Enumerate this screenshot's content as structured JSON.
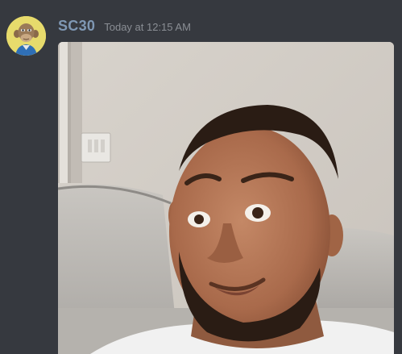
{
  "message": {
    "author": {
      "name": "SC30",
      "avatar_icon": "bored-ape-avatar-icon",
      "name_color": "#7f98b4"
    },
    "timestamp": "Today at 12:15 AM",
    "attachment": {
      "kind": "image",
      "icon": "selfie-photo"
    }
  },
  "theme": {
    "background": "#36393f",
    "timestamp_color": "#8a8e94"
  }
}
